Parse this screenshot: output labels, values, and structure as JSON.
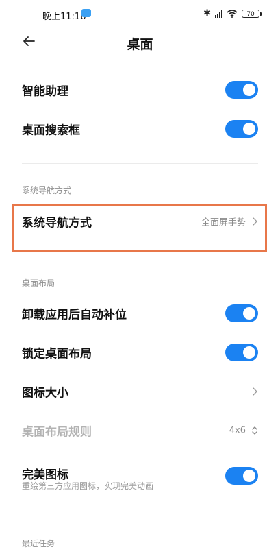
{
  "status_bar": {
    "time": "晚上11:16",
    "battery": "70",
    "icons": [
      "cloud-icon",
      "bluetooth-icon",
      "signal-icon",
      "wifi-icon",
      "battery-icon"
    ]
  },
  "header": {
    "title": "桌面",
    "back_icon": "back-arrow-icon"
  },
  "rows_top": [
    {
      "label": "智能助理",
      "toggle": true
    },
    {
      "label": "桌面搜索框",
      "toggle": true
    }
  ],
  "section_nav": {
    "title": "系统导航方式",
    "item": {
      "label": "系统导航方式",
      "value": "全面屏手势"
    }
  },
  "section_layout": {
    "title": "桌面布局",
    "items": [
      {
        "label": "卸载应用后自动补位",
        "toggle": true
      },
      {
        "label": "锁定桌面布局",
        "toggle": true
      },
      {
        "label": "图标大小"
      },
      {
        "label": "桌面布局规则",
        "value": "4x6",
        "disabled": true
      },
      {
        "label": "完美图标",
        "sub": "重绘第三方应用图标，实现完美动画",
        "toggle": true
      }
    ]
  },
  "section_recent": {
    "title": "最近任务"
  },
  "colors": {
    "accent": "#1b82f2",
    "highlight_border": "#e8774a"
  }
}
